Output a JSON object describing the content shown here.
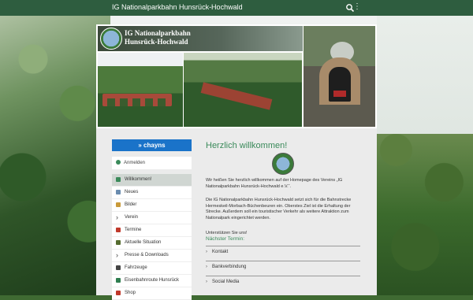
{
  "topbar": {
    "title": "IG Nationalparkbahn Hunsrück-Hochwald"
  },
  "header": {
    "banner_line1": "IG Nationalparkbahn",
    "banner_line2": "Hunsrück-Hochwald"
  },
  "chayns_label": "» chayns",
  "login_label": "Anmelden",
  "menu": [
    {
      "label": "Willkommen!",
      "active": true,
      "icon": "home-icon"
    },
    {
      "label": "Neues",
      "icon": "news-icon"
    },
    {
      "label": "Bilder",
      "icon": "image-icon"
    },
    {
      "label": "Verein",
      "icon": "chevron-icon"
    },
    {
      "label": "Termine",
      "icon": "calendar-icon"
    },
    {
      "label": "Aktuelle Situation",
      "icon": "train-icon"
    },
    {
      "label": "Presse & Downloads",
      "icon": "chevron-icon"
    },
    {
      "label": "Fahrzeuge",
      "icon": "vehicle-icon"
    },
    {
      "label": "Eisenbahnroute Hunsrück",
      "icon": "route-icon"
    },
    {
      "label": "Shop",
      "icon": "shop-icon"
    }
  ],
  "main": {
    "heading": "Herzlich willkommen!",
    "para1": "Wir heißen Sie herzlich willkommen auf der Homepage des Vereins „IG Nationalparkbahn Hunsrück-Hochwald e.V.“.",
    "para2": "Die IG Nationalparkbahn Hunsrück-Hochwald setzt sich für die Bahnstrecke Hermeskeil-Morbach-Büchenbeuren ein. Oberstes Ziel ist die Erhaltung der Strecke. Außerdem soll ein touristischer Verkehr als weitere Attraktion zum Nationalpark eingerichtet werden.",
    "para3": "Unterstützen Sie uns!",
    "next_label": "Nächster Termin:",
    "accordions": [
      "Kontakt",
      "Bankverbindung",
      "Social Media"
    ]
  },
  "colors": {
    "topbar": "#2e5d3f",
    "accent": "#3a8a5a",
    "chayns": "#1a73c9"
  }
}
